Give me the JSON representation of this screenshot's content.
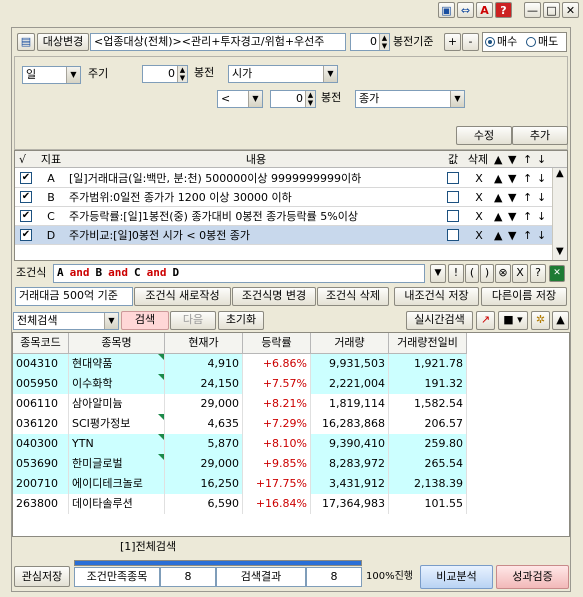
{
  "window_controls": [
    "▣",
    "⇔",
    "A",
    "?",
    "—",
    "□",
    "✕"
  ],
  "toolbar": {
    "target_change_label": "대상변경",
    "target_value": "<업종대상(전체)><관리+투자경고/위험+우선주",
    "bong_value": "0",
    "bong_label": "봉전기준",
    "plus": "+",
    "minus": "-",
    "buy_label": "매수",
    "sell_label": "매도"
  },
  "params": {
    "period_value": "일",
    "period_label": "주기",
    "bong1_value": "0",
    "bong1_label": "봉전",
    "price_field": "시가",
    "operator": "<",
    "bong2_value": "0",
    "bong2_label": "봉전",
    "price_field2": "종가"
  },
  "actions": {
    "edit": "수정",
    "add": "추가"
  },
  "cond_table": {
    "headers": {
      "check": "√",
      "index": "지표",
      "content": "내용",
      "value": "값",
      "delete": "삭제"
    },
    "rows": [
      {
        "check": "✔",
        "id": "A",
        "text": "[일]거래대금(일:백만, 분:천) 500000이상 9999999999이하",
        "x": "X"
      },
      {
        "check": "✔",
        "id": "B",
        "text": "주가범위:0일전 종가가 1200 이상 30000 이하",
        "x": "X"
      },
      {
        "check": "✔",
        "id": "C",
        "text": "주가등락률:[일]1봉전(중) 종가대비 0봉전 종가등락률 5%이상",
        "x": "X"
      },
      {
        "check": "✔",
        "id": "D",
        "text": "주가비교:[일]0봉전 시가 < 0봉전 종가",
        "x": "X"
      }
    ],
    "arrows": [
      "▲",
      "▼",
      "↑",
      "↓"
    ]
  },
  "formula": {
    "label": "조건식",
    "tokens": [
      {
        "t": "A",
        "op": false
      },
      {
        "t": "and",
        "op": true
      },
      {
        "t": "B",
        "op": false
      },
      {
        "t": "and",
        "op": true
      },
      {
        "t": "C",
        "op": false
      },
      {
        "t": "and",
        "op": true
      },
      {
        "t": "D",
        "op": false
      }
    ],
    "buttons": [
      "▼",
      "!",
      "(",
      ")",
      "⊗",
      "X",
      "?"
    ]
  },
  "formula_actions": {
    "name_value": "거래대금 500억 기준",
    "new": "조건식 새로작성",
    "change": "조건식명 변경",
    "delete": "조건식 삭제",
    "save_mine": "내조건식 저장",
    "save_as": "다른이름 저장"
  },
  "search_bar": {
    "scope": "전체검색",
    "search": "검색",
    "next": "다음",
    "reset": "초기화",
    "realtime": "실시간검색"
  },
  "results": {
    "headers": [
      "종목코드",
      "종목명",
      "현재가",
      "등락률",
      "거래량",
      "거래량전일비"
    ],
    "rows": [
      [
        "004310",
        "현대약품",
        "4,910",
        "+6.86%",
        "9,931,503",
        "1,921.78"
      ],
      [
        "005950",
        "이수화학",
        "24,150",
        "+7.57%",
        "2,221,004",
        "191.32"
      ],
      [
        "006110",
        "삼아알미늄",
        "29,000",
        "+8.21%",
        "1,819,114",
        "1,582.54"
      ],
      [
        "036120",
        "SCI평가정보",
        "4,635",
        "+7.29%",
        "16,283,868",
        "206.57"
      ],
      [
        "040300",
        "YTN",
        "5,870",
        "+8.10%",
        "9,390,410",
        "259.80"
      ],
      [
        "053690",
        "한미글로벌",
        "29,000",
        "+9.85%",
        "8,283,972",
        "265.54"
      ],
      [
        "200710",
        "에이디테크놀로",
        "16,250",
        "+17.75%",
        "3,431,912",
        "2,138.39"
      ],
      [
        "263800",
        "데이타솔루션",
        "6,590",
        "+16.84%",
        "17,364,983",
        "101.55"
      ]
    ],
    "row_colors": [
      "#ccffff",
      "#ccffff",
      "#ffffff",
      "#ffffff",
      "#ccffff",
      "#ccffff",
      "#ccffff",
      "#ffffff"
    ],
    "flag_rows": [
      true,
      true,
      false,
      true,
      true,
      true,
      false,
      false
    ]
  },
  "tab": "[1]전체검색",
  "footer": {
    "save_interest": "관심저장",
    "count_label": "조건만족종목",
    "count_value": "8",
    "result_label": "검색결과",
    "result_value": "8",
    "progress_text": "100%진행",
    "progress": 1.0,
    "compare": "비교분석",
    "verify": "성과검증"
  },
  "colors": {
    "accent_red": "#cc0000",
    "selected_row": "#c8d8ec",
    "highlight_cell": "#ccffff",
    "progress_fill": "#2a6fd6"
  }
}
